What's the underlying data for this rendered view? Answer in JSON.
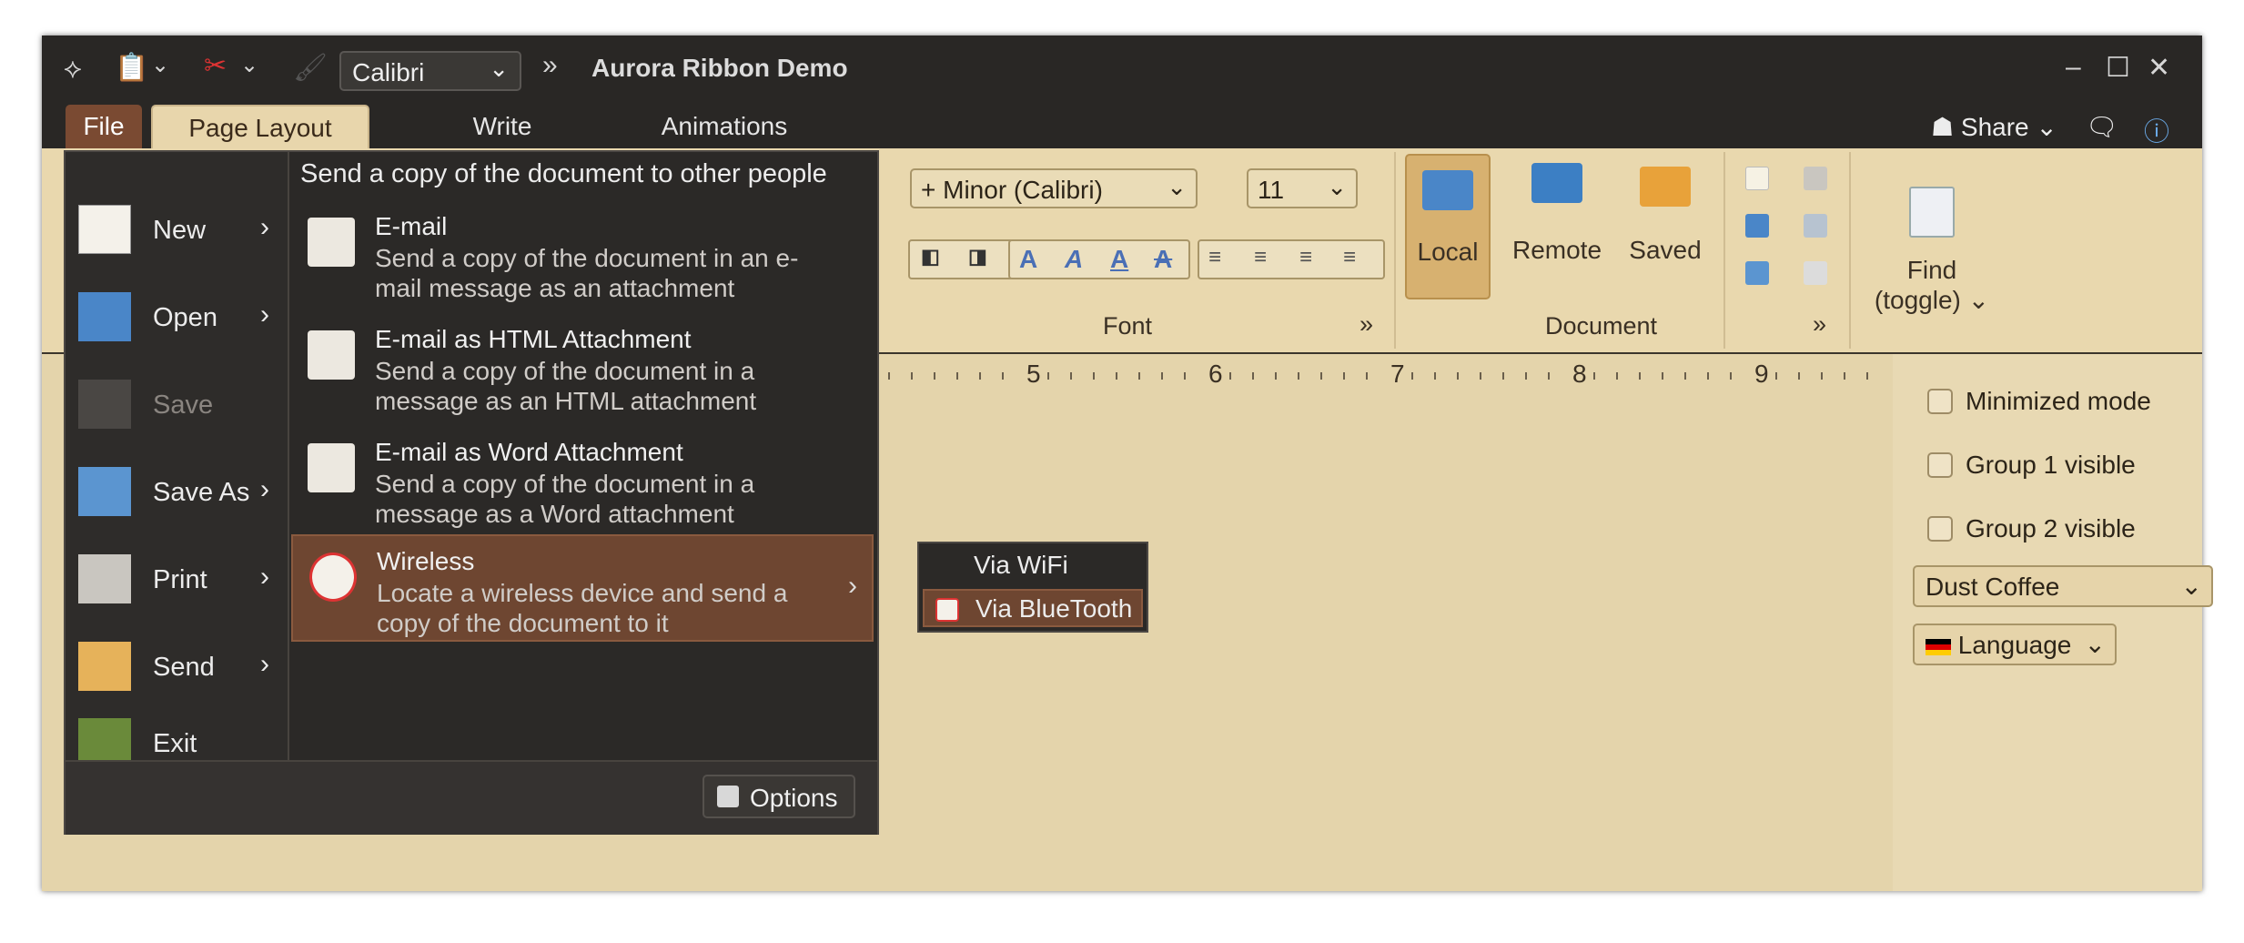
{
  "window": {
    "title": "Aurora Ribbon Demo",
    "font_combo": "Calibri",
    "overflow": "»"
  },
  "tabs": [
    {
      "label": "File"
    },
    {
      "label": "Page Layout"
    },
    {
      "label": "Write"
    },
    {
      "label": "Animations"
    }
  ],
  "top_right": {
    "share": "Share"
  },
  "ribbon": {
    "font_family": "+ Minor (Calibri)",
    "font_size": "11",
    "font_group": "Font",
    "document_group": "Document",
    "local": "Local",
    "remote": "Remote",
    "saved": "Saved",
    "find": "Find",
    "find_sub": "(toggle)",
    "expand": "»"
  },
  "ruler": {
    "numbers": [
      "5",
      "6",
      "7",
      "8",
      "9"
    ]
  },
  "right_panel": {
    "minimized": "Minimized mode",
    "group1": "Group 1 visible",
    "group2": "Group 2 visible",
    "skin": "Dust Coffee",
    "language": "Language"
  },
  "file_menu": {
    "items": [
      {
        "label": "New"
      },
      {
        "label": "Open"
      },
      {
        "label": "Save"
      },
      {
        "label": "Save As"
      },
      {
        "label": "Print"
      },
      {
        "label": "Send"
      },
      {
        "label": "Exit"
      }
    ],
    "header": "Send a copy of the document to other people",
    "send_items": [
      {
        "title": "E-mail",
        "desc": "Send a copy of the document in an e-mail message as an attachment"
      },
      {
        "title": "E-mail as HTML Attachment",
        "desc": "Send a copy of the document in a message as an HTML attachment"
      },
      {
        "title": "E-mail as Word Attachment",
        "desc": "Send a copy of the document in a message as a Word attachment"
      },
      {
        "title": "Wireless",
        "desc": "Locate a wireless device and send a copy of the document to it"
      }
    ],
    "options": "Options"
  },
  "wireless_submenu": [
    {
      "label": "Via WiFi"
    },
    {
      "label": "Via BlueTooth"
    }
  ]
}
